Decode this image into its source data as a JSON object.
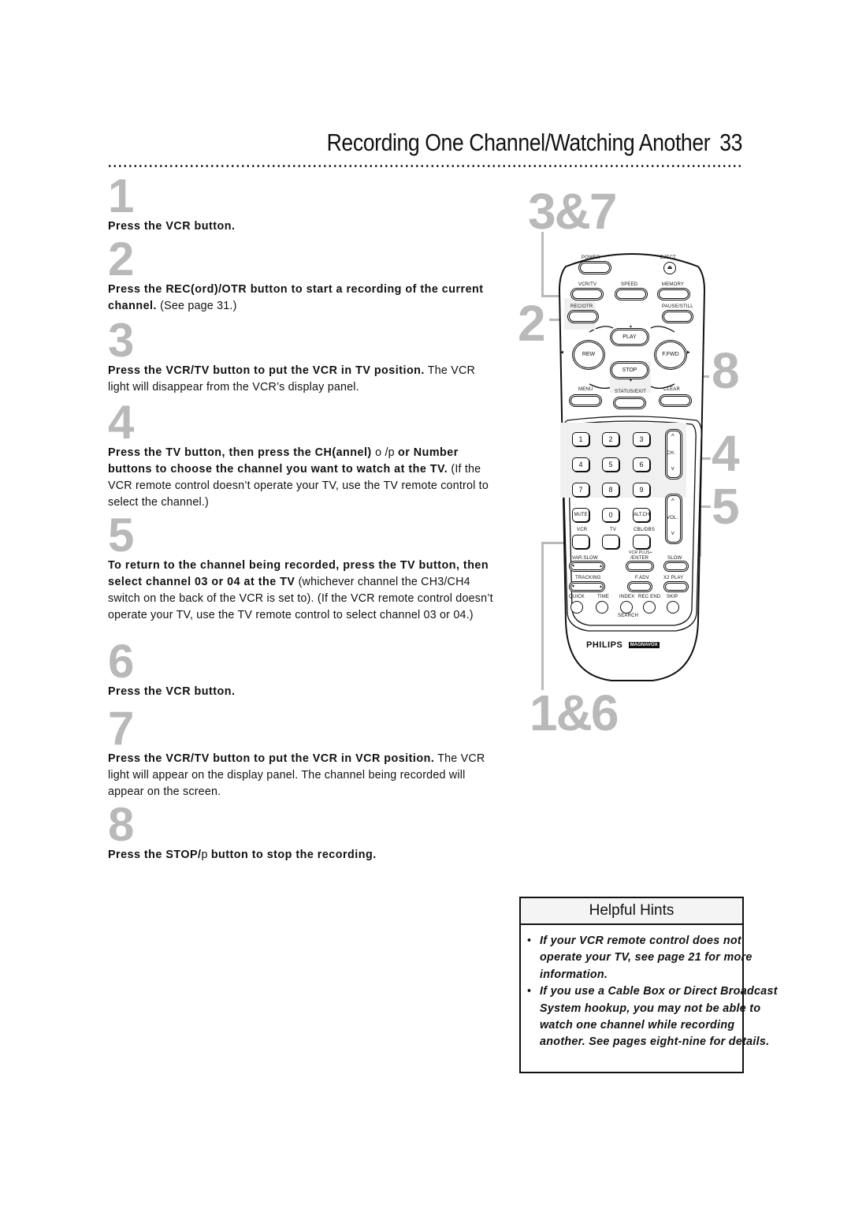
{
  "header": {
    "title": "Recording One Channel/Watching Another",
    "page_number": "33"
  },
  "steps": [
    {
      "number": "1",
      "bold": "Press the VCR button.",
      "normal": ""
    },
    {
      "number": "2",
      "bold": "Press the REC(ord)/OTR button to start a recording of the current channel.",
      "normal": " (See page 31.)"
    },
    {
      "number": "3",
      "bold": "Press the VCR/TV button to put the VCR in TV position.",
      "normal": " The VCR light will disappear from the VCR’s display panel."
    },
    {
      "number": "4",
      "bold_a": "Press the TV button, then press the CH(annel) ",
      "symbols": "o /p ",
      "bold_b": " or Number buttons to choose the channel you want to watch at the TV.",
      "normal": " (If the VCR remote control doesn’t operate your TV, use the TV remote control to select the channel.)"
    },
    {
      "number": "5",
      "bold": "To return to the channel being recorded, press the TV button, then select channel 03 or 04 at the TV",
      "normal": " (whichever channel the CH3/CH4 switch on the back of the VCR is set to). (If the VCR remote control doesn’t operate your TV, use the TV remote control to select channel 03 or 04.)"
    },
    {
      "number": "6",
      "bold": "Press the VCR button.",
      "normal": ""
    },
    {
      "number": "7",
      "bold": "Press the VCR/TV button to put the VCR in VCR position.",
      "normal": " The VCR light will appear on the display panel. The channel being recorded will appear on the screen."
    },
    {
      "number": "8",
      "bold_a": "Press the STOP/",
      "symbols": "p ",
      "bold_b": " button to stop the recording.",
      "normal": ""
    }
  ],
  "diagram": {
    "callouts": {
      "c37": "3&7",
      "c2": "2",
      "c8": "8",
      "c4": "4",
      "c5": "5",
      "c16": "1&6"
    },
    "remote": {
      "power": "POWER",
      "eject": "EJECT",
      "eject_glyph": "⏏",
      "vcrtv": "VCR/TV",
      "speed": "SPEED",
      "memory": "MEMORY",
      "recotr": "REC/OTR",
      "pause": "PAUSE/STILL",
      "play": "PLAY",
      "rew": "REW",
      "ffwd": "F.FWD",
      "stop": "STOP",
      "arrow_up": "▲",
      "arrow_down": "▼",
      "arrow_left": "◀",
      "arrow_right": "▶",
      "menu": "MENU",
      "status": "STATUS/EXIT",
      "clear": "CLEAR",
      "keys": [
        "1",
        "2",
        "3",
        "4",
        "5",
        "6",
        "7",
        "8",
        "9"
      ],
      "mute": "MUTE",
      "zero": "0",
      "altch": "ALT.CH",
      "ch": "CH.",
      "vol": "VOL.",
      "caret_up": "^",
      "caret_down": "v",
      "vcr": "VCR",
      "tv": "TV",
      "cbl": "CBL/DBS",
      "varslow": "VAR.SLOW",
      "vcrplus": "VCR PLUS+",
      "enter": "/ENTER",
      "slow": "SLOW",
      "tracking": "TRACKING",
      "fadv": "F.ADV",
      "x2play": "X2 PLAY",
      "quick": "QUICK",
      "time": "TIME",
      "index": "INDEX",
      "recend": "REC END",
      "skip": "SKIP",
      "search": "SEARCH",
      "brand1": "PHILIPS",
      "brand2": "MAGNAVOX"
    }
  },
  "hints": {
    "title": "Helpful Hints",
    "items": [
      "If your VCR remote control does not operate your TV, see page 21 for more information.",
      "If you use a Cable Box or Direct Broadcast System hookup, you may not be able to watch one channel while recording another. See pages eight-nine for details."
    ]
  }
}
